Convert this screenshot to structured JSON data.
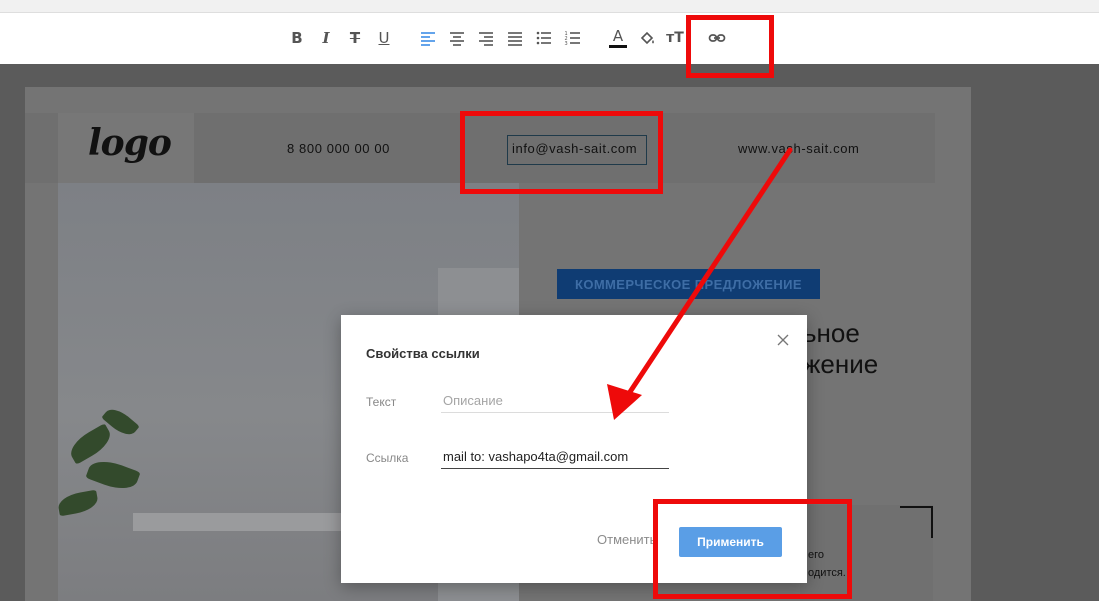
{
  "toolbar": {
    "items": [
      {
        "name": "bold-icon",
        "glyph": "B"
      },
      {
        "name": "italic-icon",
        "glyph": "I"
      },
      {
        "name": "strikethrough-icon",
        "glyph": "T"
      },
      {
        "name": "underline-icon",
        "glyph": "U"
      },
      {
        "name": "align-left-icon"
      },
      {
        "name": "align-center-icon"
      },
      {
        "name": "align-right-icon"
      },
      {
        "name": "align-justify-icon"
      },
      {
        "name": "bullet-list-icon"
      },
      {
        "name": "numbered-list-icon"
      },
      {
        "name": "text-color-icon",
        "glyph": "A"
      },
      {
        "name": "fill-color-icon"
      },
      {
        "name": "font-size-icon",
        "glyph": "тT"
      },
      {
        "name": "link-icon"
      }
    ]
  },
  "page_header": {
    "logo": "logo",
    "phone": "8 800 000 00 00",
    "email": "info@vash-sait.com",
    "website": "www.vash-sait.com"
  },
  "hero": {
    "tag": "КОММЕРЧЕСКОЕ ПРЕДЛОЖЕНИЕ",
    "line1_fragment": "ьное",
    "line2_fragment": "жение"
  },
  "card_fragment": {
    "line1": "его",
    "line2": "одится."
  },
  "modal": {
    "title": "Свойства ссылки",
    "text_label": "Текст",
    "text_placeholder": "Описание",
    "text_value": "",
    "link_label": "Ссылка",
    "link_value": "mail to: vashapo4ta@gmail.com",
    "cancel_label": "Отменить",
    "apply_label": "Применить"
  },
  "colors": {
    "highlight": "#ee0a0a",
    "accent": "#3d8ee6",
    "apply_button": "#5a9ee6",
    "tag_background": "#0f3c73"
  }
}
